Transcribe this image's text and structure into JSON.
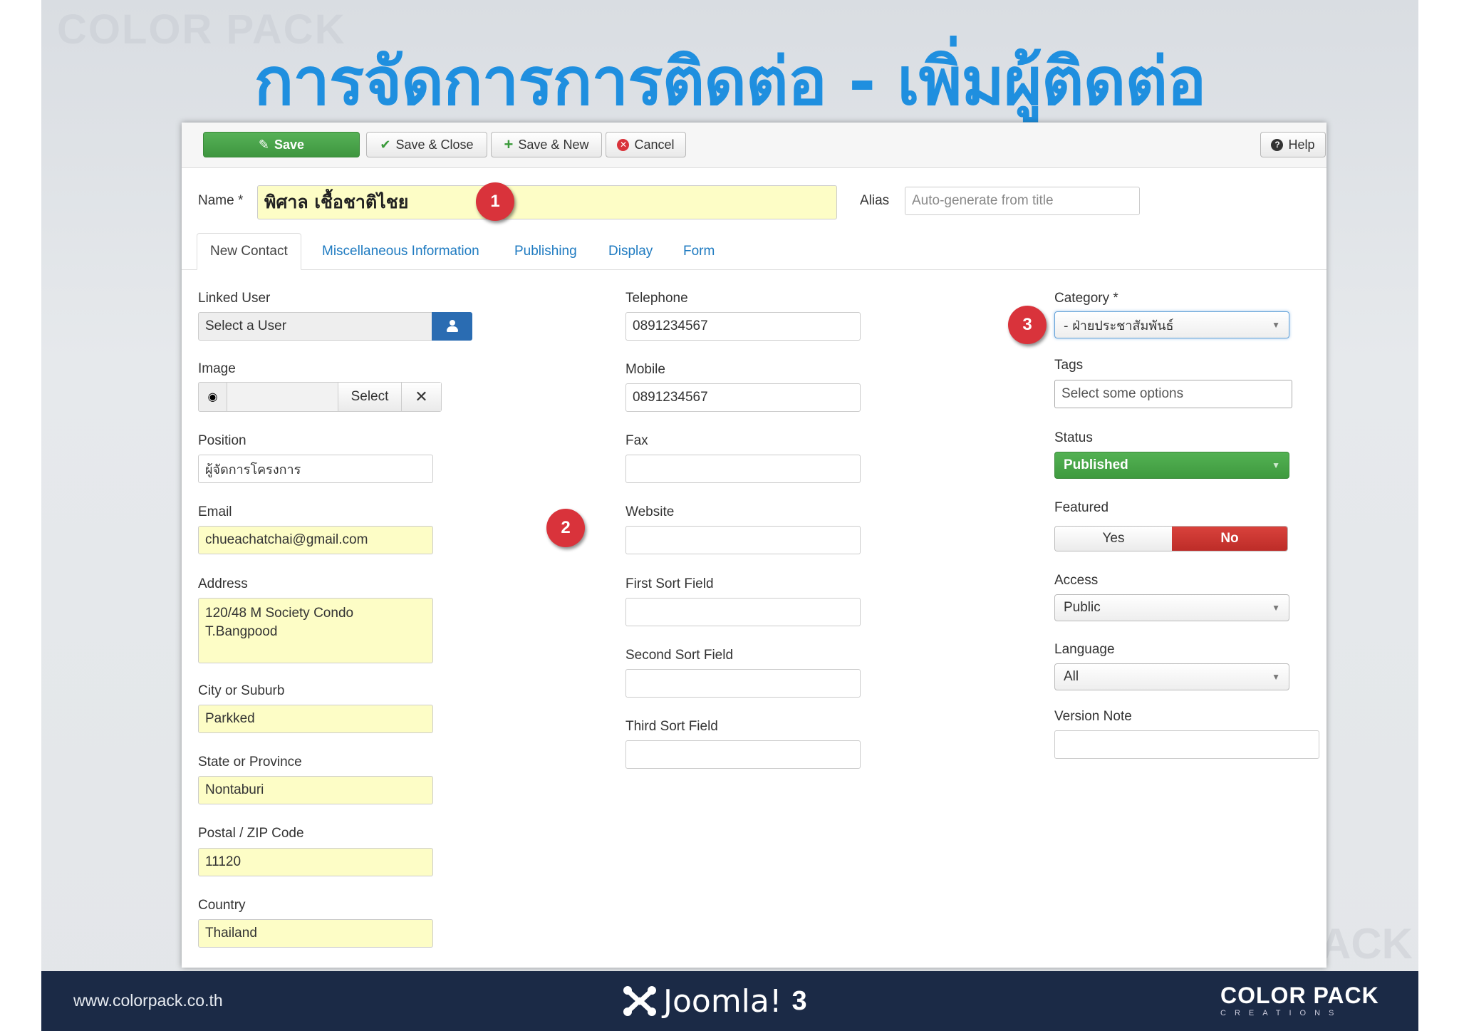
{
  "slide": {
    "title": "การจัดการการติดต่อ - เพิ่มผู้ติดต่อ",
    "watermark_top": "COLOR PACK",
    "watermark_bottom": "PACK"
  },
  "toolbar": {
    "save": "Save",
    "save_close": "Save & Close",
    "save_new": "Save & New",
    "cancel": "Cancel",
    "help": "Help"
  },
  "header": {
    "name_label": "Name *",
    "name_value": "พิศาล เชื้อชาติไชย",
    "alias_label": "Alias",
    "alias_placeholder": "Auto-generate from title"
  },
  "tabs": [
    "New Contact",
    "Miscellaneous Information",
    "Publishing",
    "Display",
    "Form"
  ],
  "left": {
    "linked_user_label": "Linked User",
    "linked_user_value": "Select a User",
    "image_label": "Image",
    "image_select": "Select",
    "position_label": "Position",
    "position_value": "ผู้จัดการโครงการ",
    "email_label": "Email",
    "email_value": "chueachatchai@gmail.com",
    "address_label": "Address",
    "address_line1": "120/48 M Society Condo",
    "address_line2": "T.Bangpood",
    "city_label": "City or Suburb",
    "city_value": "Parkked",
    "state_label": "State or Province",
    "state_value": "Nontaburi",
    "postal_label": "Postal / ZIP Code",
    "postal_value": "11120",
    "country_label": "Country",
    "country_value": "Thailand"
  },
  "middle": {
    "telephone_label": "Telephone",
    "telephone_value": "0891234567",
    "mobile_label": "Mobile",
    "mobile_value": "0891234567",
    "fax_label": "Fax",
    "website_label": "Website",
    "sort1_label": "First Sort Field",
    "sort2_label": "Second Sort Field",
    "sort3_label": "Third Sort Field"
  },
  "right": {
    "category_label": "Category *",
    "category_value": "- ฝ่ายประชาสัมพันธ์",
    "tags_label": "Tags",
    "tags_placeholder": "Select some options",
    "status_label": "Status",
    "status_value": "Published",
    "featured_label": "Featured",
    "featured_yes": "Yes",
    "featured_no": "No",
    "access_label": "Access",
    "access_value": "Public",
    "language_label": "Language",
    "language_value": "All",
    "version_note_label": "Version Note"
  },
  "badges": [
    "1",
    "2",
    "3"
  ],
  "footer": {
    "url": "www.colorpack.co.th",
    "joomla": "Joomla!",
    "joomla_version": "3",
    "brand_main": "COLOR PACK",
    "brand_sub": "CREATIONS"
  },
  "colors": {
    "title": "#1f8fdf",
    "save_green": "#46a546",
    "status_green": "#46a546",
    "featured_no_red": "#c9302c",
    "highlight_yellow": "#fdfdc6",
    "badge_red": "#d9333b",
    "footer_navy": "#1b2a46",
    "link_blue": "#1f7bc1"
  },
  "icons": {
    "save": "edit-icon",
    "save_close": "check-icon",
    "save_new": "plus-icon",
    "cancel": "cancel-circle-icon",
    "help": "question-icon",
    "linked_user": "user-icon",
    "image_preview": "eye-icon",
    "image_clear": "x-icon"
  }
}
